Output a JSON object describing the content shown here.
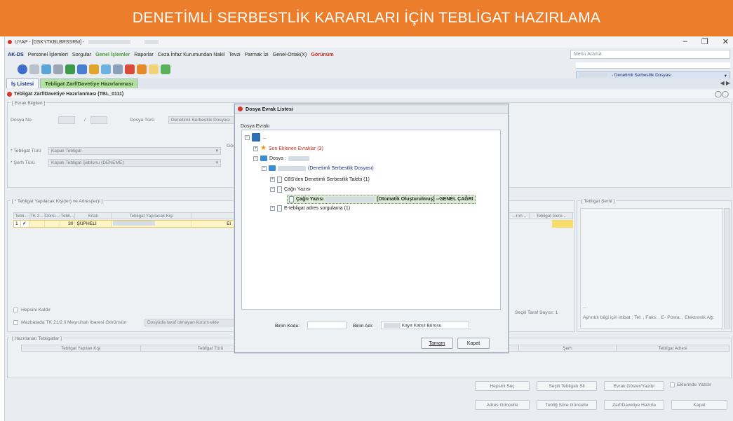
{
  "banner": {
    "title": "DENETİMLİ SERBESTLİK KARARLARI İÇİN TEBLİGAT HAZIRLAMA"
  },
  "window": {
    "title": "UYAP - [DSKYTKBLBRSSRM] -",
    "minimize": "–",
    "maximize": "❐",
    "close": "✕"
  },
  "menu": {
    "items": [
      "AK-DS",
      "Personel İşlemleri",
      "Sorgular",
      "Genel İşlemler",
      "Raporlar",
      "Ceza İnfaz Kurumundan Nakil",
      "Tevzi",
      "Parmak İzi",
      "Genel-Ortak(X)",
      "Görünüm"
    ],
    "search_placeholder": "Menu Arama"
  },
  "file_type": {
    "label": "- Denetimli Serbestlik Dosyası"
  },
  "tabs": [
    {
      "label": "İş Listesi"
    },
    {
      "label": "Tebligat Zarf/Davetiye Hazırlanması"
    }
  ],
  "tab_nav": "◀ ▶",
  "form": {
    "title": "Tebligat Zarf/Davetiye Hazırlanması (TBL_0111)"
  },
  "evrak": {
    "legend": "[ Evrak Bilgileri ]",
    "dosya_no_label": "Dosya No",
    "slash": "/",
    "dosya_turu_label": "Dosya Türü",
    "dosya_turu_value": "Denetimli Serbestlik Dosyası",
    "tebligat_turu_label": "* Tebligat Türü",
    "tebligat_turu_value": "Kapalı Tebligat",
    "gon_label": "Gön",
    "serh_turu_label": "* Şerh Türü",
    "serh_turu_value": "Kapalı Tebligat Şablonu (DENEME)"
  },
  "kisiler": {
    "legend": "[ * Tebligat Yapılacak Kişi(ler) ve Adres(ler)i ]",
    "columns": [
      "Tebli...",
      "TK 2...",
      "Dönü...",
      "Tebli...",
      "Sıfatı",
      "Tebligat Yapılacak Kişi",
      ""
    ],
    "row": {
      "num": "1",
      "check": "✓",
      "days": "30",
      "sifat": "ŞÜPHELİ",
      "tail": "El"
    },
    "extra_columns": [
      "...rım...",
      "Tebligat Gere..."
    ],
    "hepsini_kaldir": "Hepsini Kaldır",
    "mazbata_text": "Mazbatada TK 21/2 li Meşruhatı İbaresi Görünsün",
    "dosyada_text": "Dosyada taraf olmayan kurum ekle",
    "secili_taraf": "Seçili Taraf Sayısı: 1"
  },
  "serh": {
    "legend": "[ Tebligat Şerhi ]",
    "dots": "...",
    "info": "Ayrıntılı bilgi için irtibat ; Tel: , Faks: , E- Posta: , Elektronik Ağ:"
  },
  "hazirlanan": {
    "legend": "[ Hazırlanan Tebligatlar ]",
    "columns": [
      "Tebligat Yapılan Kişi",
      "Tebligat Türü",
      "Şerh",
      "Tebligat Adresi"
    ]
  },
  "bottom_buttons": {
    "hepsini_sec": "Hepsini Seç",
    "secili_sil": "Seçili Tebligatı Sil",
    "evrak_goster": "Evrak Göster/Yazdır",
    "eklerinde": "Eklerinde Yazdır",
    "adres_guncelle": "Adres Güncelle",
    "tebligat_sure": "Tebliğ Süre Güncelle",
    "zarf_hazirla": "Zarf/Davetiye Hazırla",
    "kapat": "Kapat"
  },
  "dialog": {
    "title": "Dosya Evrak Listesi",
    "subtitle": "Dosya Evrakı",
    "root": "...",
    "son_eklenen": "Son Eklenen Evraklar (3)",
    "dosya": "Dosya :",
    "dosya_sub": "(Denetimli Serbestlik Dosyası)",
    "cbs": "CBS'den Denetimli Serbestlik Talebi (1)",
    "cagri": "Çağrı Yazısı",
    "cagri_leaf_name": "Çağrı Yazısı",
    "cagri_leaf_rest": "[Otomatik Oluşturulmuş] --GENEL ÇAĞRI",
    "etebligat": "E-tebligat adres sorgulama (1)",
    "birim_kodu_label": "Birim Kodu:",
    "birim_adi_label": "Birim Adı:",
    "birim_adi_value": "Kayıt Kabul Bürosu",
    "tamam": "Tamam",
    "kapat": "Kapat"
  },
  "colors": {
    "banner": "#ec7d2a",
    "active_tab": "#b6e0a3",
    "selected_row": "#fff6c6"
  }
}
